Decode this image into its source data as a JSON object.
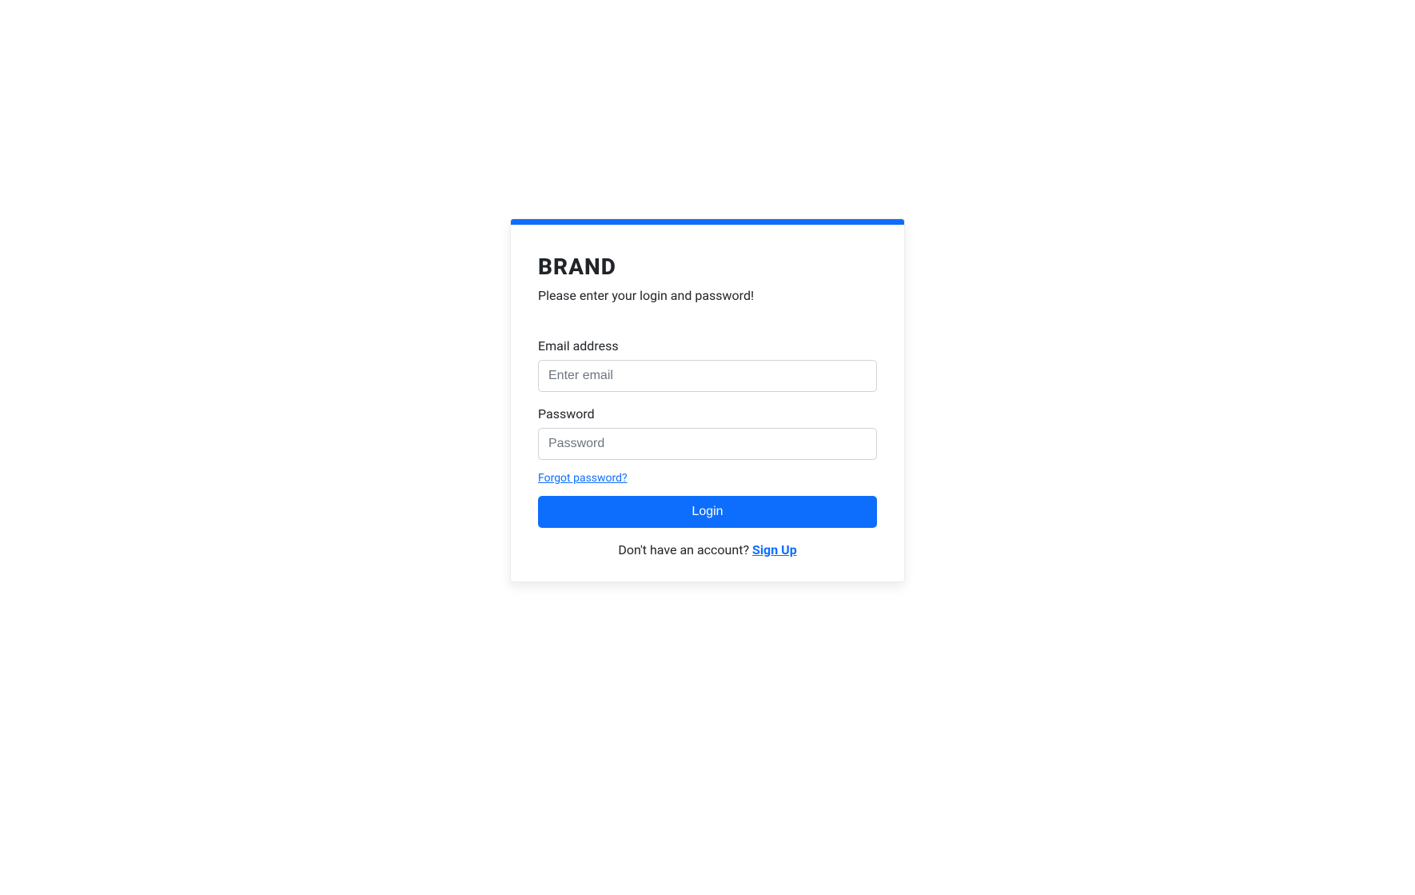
{
  "brand": "BRAND",
  "subtitle": "Please enter your login and password!",
  "form": {
    "email_label": "Email address",
    "email_placeholder": "Enter email",
    "email_value": "",
    "password_label": "Password",
    "password_placeholder": "Password",
    "password_value": "",
    "forgot_link": "Forgot password?",
    "login_button": "Login"
  },
  "signup": {
    "prompt": "Don't have an account? ",
    "link": "Sign Up"
  },
  "colors": {
    "primary": "#0d6efd"
  }
}
